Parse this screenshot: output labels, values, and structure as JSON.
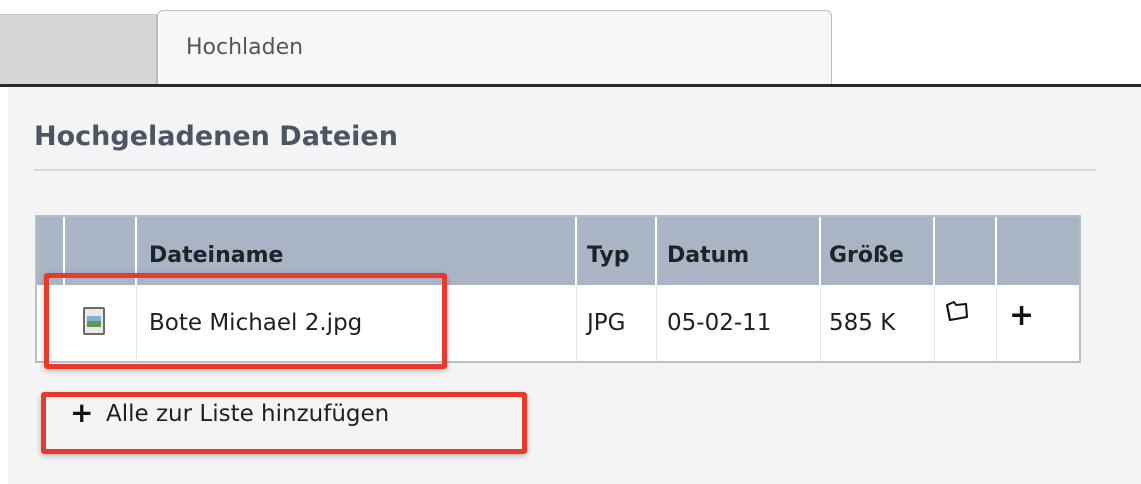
{
  "tabs": [
    {
      "label": ""
    },
    {
      "label": "Hochladen"
    }
  ],
  "section": {
    "title": "Hochgeladenen Dateien"
  },
  "table": {
    "headers": [
      "",
      "",
      "Dateiname",
      "Typ",
      "Datum",
      "Größe",
      "",
      ""
    ],
    "rows": [
      {
        "filename": "Bote Michael 2.jpg",
        "type": "JPG",
        "date": "05-02-11",
        "size": "585 K",
        "add": "+"
      }
    ]
  },
  "actions": {
    "add_all_plus": "+",
    "add_all_label": "Alle zur Liste hinzufügen"
  },
  "icons": {
    "file": "image-file-icon",
    "folder": "folder-icon",
    "add": "plus-icon"
  },
  "colors": {
    "highlight": "#e83a2c",
    "header_bg": "#a9b4c5",
    "title": "#4b5563"
  }
}
